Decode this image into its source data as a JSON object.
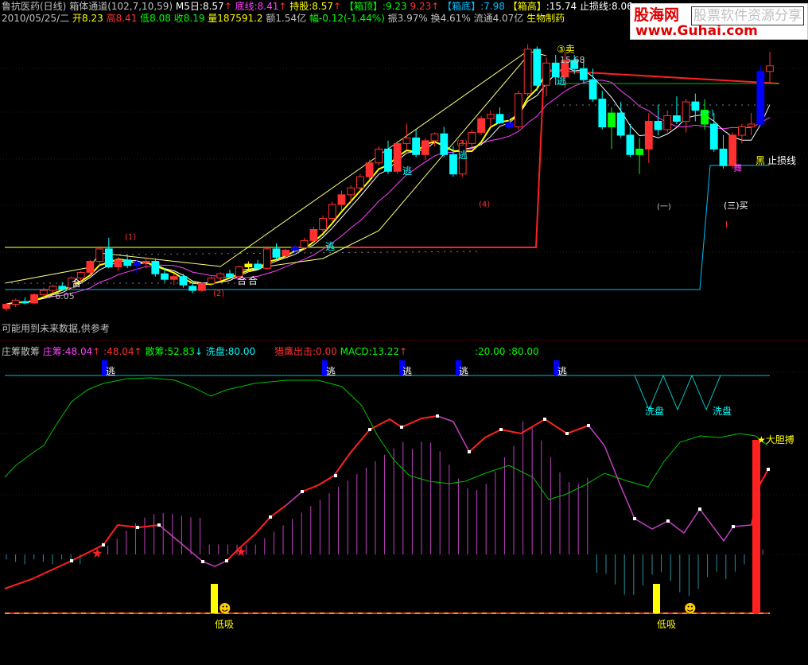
{
  "header": {
    "stock": "鲁抗医药(日线)",
    "indicator": "箱体通道(102,7,10,59)",
    "m5": "M5日:8.57",
    "bottom_line": "底线:8.41",
    "hold": "持股:8.57",
    "box_top_label": "【箱顶】",
    "box_top_val": ":9.23",
    "box_top_val2": "9.23",
    "box_bottom_label": "【箱底】",
    "box_bottom_val": ":7.98",
    "box_high_label": "【箱高】",
    "box_high_val": ":15.74",
    "stop_loss": "止损线:8.06"
  },
  "quote": {
    "date": "2010/05/25/二",
    "open": "开8.23",
    "high": "高8.41",
    "low": "低8.08",
    "close": "收8.19",
    "vol": "量187591.2",
    "amount": "额1.54亿",
    "change": "幅-0.12(-1.44%)",
    "amplitude": "振3.97%",
    "turnover": "换4.61%",
    "float": "流通4.07亿",
    "sector": "生物制药"
  },
  "logo": {
    "name": "股海网",
    "slogan": "股票软件资源分享",
    "url": "www.Guhai.com"
  },
  "colors": {
    "up": "#ff3030",
    "down": "#00ffff",
    "yellow": "#ffff00",
    "magenta": "#ff40ff",
    "green": "#00ff00",
    "blue": "#0000ff",
    "cyan": "#00c0ff"
  },
  "main_labels": {
    "p1": "(1)",
    "p2": "(2)",
    "p3": "(3)",
    "p4": "(4)",
    "sell": "③卖",
    "sell_price": "15.68",
    "low_price": "←6.05",
    "he1": "合",
    "he2": "合",
    "he3": "合",
    "tao": "逃",
    "stop_line": "止损线",
    "hei": "黑",
    "minus1": "(一)",
    "minus2": "(一)",
    "buy": "(三)买",
    "wu": "舞",
    "i_mark": "I"
  },
  "notice": "可能用到未来数据,供参考",
  "sub_header": {
    "name": "庄筹散筹",
    "zhuang": "庄筹:48.04",
    "val2": ":48.04",
    "san": "散筹:52.83",
    "xipan": "洗盘:80.00",
    "lieying": "猎鹰出击:0.00",
    "macd": "MACD:13.22",
    "refs": ":20.00 :80.00"
  },
  "sub_labels": {
    "tao": "逃",
    "xipan1": "洗盘",
    "xipan2": "洗盘",
    "dadan": "大胆搏",
    "dixi1": "低吸",
    "dixi2": "低吸"
  },
  "chart_data": {
    "type": "candlestick",
    "candles": [
      [
        6.15,
        6.35,
        6.05,
        6.3
      ],
      [
        6.3,
        6.5,
        6.2,
        6.45
      ],
      [
        6.4,
        6.55,
        6.3,
        6.35
      ],
      [
        6.35,
        6.7,
        6.3,
        6.65
      ],
      [
        6.65,
        6.9,
        6.55,
        6.8
      ],
      [
        6.8,
        7.0,
        6.7,
        6.95
      ],
      [
        6.95,
        7.1,
        6.8,
        6.85
      ],
      [
        6.9,
        7.3,
        6.85,
        7.25
      ],
      [
        7.25,
        7.5,
        7.1,
        7.45
      ],
      [
        7.45,
        7.9,
        7.35,
        7.85
      ],
      [
        7.85,
        8.4,
        7.7,
        8.3
      ],
      [
        8.3,
        8.7,
        7.6,
        7.65
      ],
      [
        7.65,
        8.0,
        7.5,
        7.9
      ],
      [
        7.9,
        8.1,
        7.6,
        7.7
      ],
      [
        7.7,
        7.9,
        7.4,
        7.8
      ],
      [
        7.8,
        8.0,
        7.6,
        7.85
      ],
      [
        7.85,
        7.95,
        7.3,
        7.4
      ],
      [
        7.4,
        7.6,
        7.1,
        7.2
      ],
      [
        7.2,
        7.4,
        7.0,
        7.3
      ],
      [
        7.3,
        7.4,
        6.9,
        7.0
      ],
      [
        6.95,
        7.1,
        6.7,
        6.8
      ],
      [
        6.8,
        7.1,
        6.75,
        7.05
      ],
      [
        7.05,
        7.3,
        6.95,
        7.25
      ],
      [
        7.25,
        7.45,
        7.15,
        7.4
      ],
      [
        7.4,
        7.55,
        7.25,
        7.3
      ],
      [
        7.3,
        7.7,
        7.25,
        7.65
      ],
      [
        7.65,
        7.85,
        7.5,
        7.75
      ],
      [
        7.75,
        7.9,
        7.55,
        7.6
      ],
      [
        7.6,
        8.4,
        7.55,
        8.3
      ],
      [
        8.3,
        8.5,
        7.9,
        8.0
      ],
      [
        8.05,
        8.3,
        7.95,
        8.25
      ],
      [
        8.25,
        8.45,
        8.1,
        8.35
      ],
      [
        8.35,
        8.7,
        8.25,
        8.6
      ],
      [
        8.6,
        9.1,
        8.5,
        9.0
      ],
      [
        9.0,
        9.5,
        8.9,
        9.4
      ],
      [
        9.4,
        10.0,
        9.3,
        9.9
      ],
      [
        9.9,
        10.4,
        9.7,
        10.25
      ],
      [
        10.25,
        10.6,
        10.0,
        10.5
      ],
      [
        10.5,
        11.0,
        10.4,
        10.9
      ],
      [
        10.9,
        11.5,
        10.8,
        11.4
      ],
      [
        11.4,
        12.0,
        11.3,
        11.9
      ],
      [
        11.9,
        12.2,
        11.0,
        11.1
      ],
      [
        11.1,
        12.2,
        11.0,
        12.1
      ],
      [
        12.1,
        12.8,
        11.9,
        12.3
      ],
      [
        12.3,
        12.6,
        11.6,
        11.7
      ],
      [
        11.7,
        12.3,
        11.5,
        12.2
      ],
      [
        12.2,
        12.5,
        12.0,
        12.45
      ],
      [
        12.45,
        12.7,
        11.6,
        11.7
      ],
      [
        11.7,
        12.0,
        10.9,
        11.0
      ],
      [
        11.0,
        12.2,
        10.9,
        12.1
      ],
      [
        12.1,
        12.6,
        11.95,
        12.5
      ],
      [
        12.5,
        13.1,
        12.4,
        13.0
      ],
      [
        13.0,
        13.3,
        12.7,
        13.15
      ],
      [
        13.15,
        13.4,
        12.8,
        12.85
      ],
      [
        12.85,
        13.2,
        12.6,
        12.7
      ],
      [
        12.7,
        14.0,
        12.6,
        13.9
      ],
      [
        13.9,
        15.68,
        13.8,
        15.5
      ],
      [
        15.5,
        15.6,
        14.0,
        14.2
      ],
      [
        14.2,
        15.2,
        13.8,
        15.0
      ],
      [
        15.0,
        15.3,
        14.2,
        14.5
      ],
      [
        14.5,
        15.4,
        14.1,
        15.1
      ],
      [
        15.1,
        15.3,
        14.6,
        14.8
      ],
      [
        14.8,
        15.2,
        14.3,
        14.4
      ],
      [
        14.4,
        14.8,
        13.6,
        13.7
      ],
      [
        13.7,
        14.0,
        12.6,
        12.7
      ],
      [
        12.7,
        13.4,
        11.9,
        13.2
      ],
      [
        13.2,
        13.6,
        12.3,
        12.4
      ],
      [
        12.4,
        12.8,
        11.6,
        11.7
      ],
      [
        11.7,
        12.3,
        11.0,
        11.9
      ],
      [
        11.9,
        13.2,
        11.4,
        12.9
      ],
      [
        12.9,
        13.5,
        12.4,
        12.6
      ],
      [
        12.6,
        13.3,
        12.5,
        13.1
      ],
      [
        13.1,
        13.8,
        12.8,
        12.9
      ],
      [
        12.9,
        13.7,
        12.5,
        13.6
      ],
      [
        13.6,
        13.9,
        12.9,
        13.3
      ],
      [
        13.3,
        13.7,
        12.6,
        12.8
      ],
      [
        12.8,
        13.2,
        11.8,
        11.9
      ],
      [
        11.9,
        12.4,
        11.2,
        11.3
      ],
      [
        11.3,
        12.5,
        11.2,
        12.4
      ],
      [
        12.4,
        12.8,
        12.1,
        12.7
      ],
      [
        12.7,
        13.2,
        12.4,
        12.8
      ],
      [
        12.8,
        14.9,
        12.7,
        14.7
      ],
      [
        14.7,
        15.4,
        14.3,
        14.9
      ]
    ],
    "y_range": [
      5.8,
      16.3
    ],
    "sub_y_range": [
      -15,
      100
    ]
  }
}
